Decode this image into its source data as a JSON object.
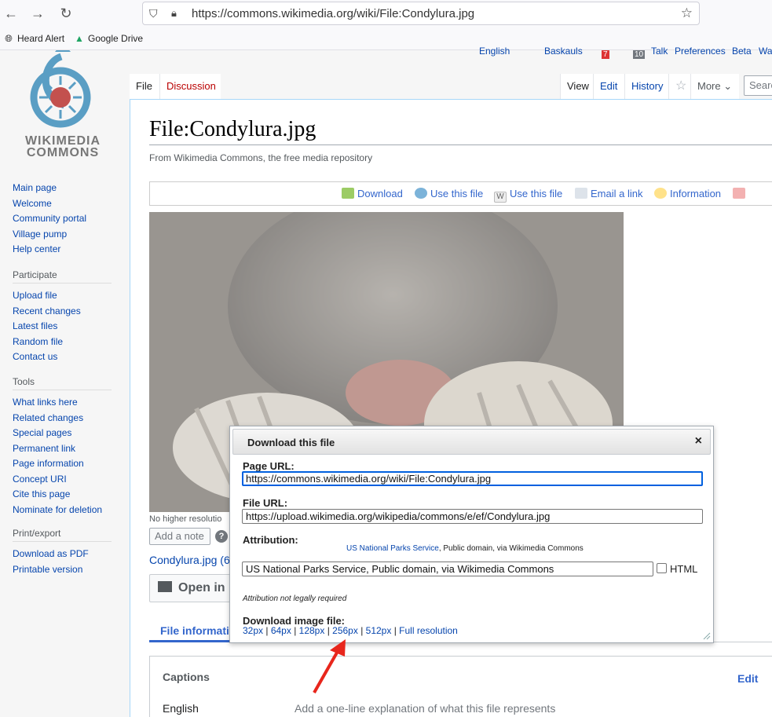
{
  "browser": {
    "url": "https://commons.wikimedia.org/wiki/File:Condylura.jpg",
    "bookmarks": [
      "Heard Alert",
      "Google Drive"
    ]
  },
  "personal_tools": [
    "English",
    "Baskauls",
    "7",
    "10",
    "Talk",
    "Preferences",
    "Beta",
    "Wa"
  ],
  "logo": {
    "line1": "WIKIMEDIA",
    "line2": "COMMONS"
  },
  "sidebar": {
    "nav": [
      "Main page",
      "Welcome",
      "Community portal",
      "Village pump",
      "Help center"
    ],
    "participate": {
      "heading": "Participate",
      "items": [
        "Upload file",
        "Recent changes",
        "Latest files",
        "Random file",
        "Contact us"
      ]
    },
    "tools": {
      "heading": "Tools",
      "items": [
        "What links here",
        "Related changes",
        "Special pages",
        "Permanent link",
        "Page information",
        "Concept URI",
        "Cite this page",
        "Nominate for deletion"
      ]
    },
    "print": {
      "heading": "Print/export",
      "items": [
        "Download as PDF",
        "Printable version"
      ]
    }
  },
  "tabs": {
    "file": "File",
    "discussion": "Discussion",
    "view": "View",
    "edit": "Edit",
    "history": "History",
    "more": "More",
    "search_placeholder": "Search"
  },
  "page": {
    "title": "File:Condylura.jpg",
    "subtitle": "From Wikimedia Commons, the free media repository",
    "tools": [
      "Download",
      "Use this file",
      "Use this file",
      "Email a link",
      "Information"
    ],
    "no_higher_res": "No higher resolutio",
    "add_note": "Add a note",
    "file_link": "Condylura.jpg (6",
    "open_in": "Open in",
    "file_info_tab": "File informatio",
    "captions": {
      "title": "Captions",
      "edit": "Edit",
      "lang": "English",
      "placeholder": "Add a one-line explanation of what this file represents"
    }
  },
  "dialog": {
    "title": "Download this file",
    "close": "×",
    "page_url_label": "Page URL:",
    "page_url": "https://commons.wikimedia.org/wiki/File:Condylura.jpg",
    "file_url_label": "File URL:",
    "file_url": "https://upload.wikimedia.org/wikipedia/commons/e/ef/Condylura.jpg",
    "attribution_label": "Attribution:",
    "attribution_link": "US National Parks Service",
    "attribution_rest": ", Public domain, via Wikimedia Commons",
    "attribution_text": "US National Parks Service, Public domain, via Wikimedia Commons",
    "html_label": "HTML",
    "attribution_note": "Attribution not legally required",
    "download_label": "Download image file:",
    "sizes": [
      "32px",
      "64px",
      "128px",
      "256px",
      "512px",
      "Full resolution"
    ]
  },
  "colors": {
    "link": "#0645ad",
    "progressive": "#3366cc",
    "annotation_arrow": "#e8261c"
  }
}
